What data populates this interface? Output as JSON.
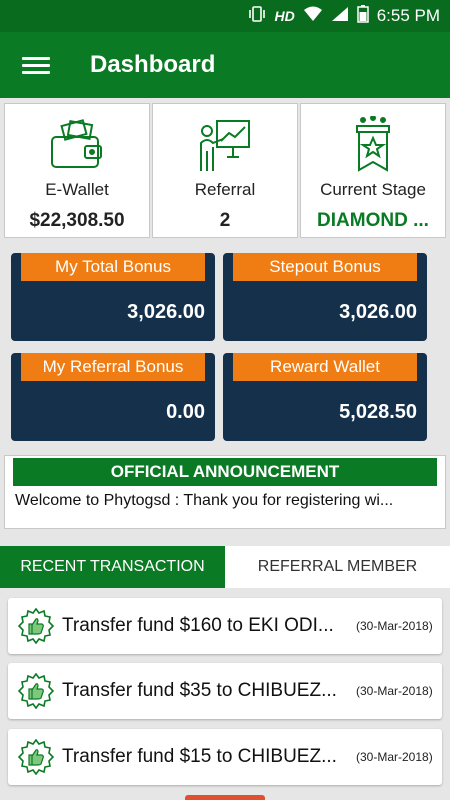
{
  "status": {
    "network": "HD",
    "time": "6:55 PM"
  },
  "header": {
    "title": "Dashboard"
  },
  "summary_cards": [
    {
      "label": "E-Wallet",
      "value": "$22,308.50",
      "icon": "wallet-icon"
    },
    {
      "label": "Referral",
      "value": "2",
      "icon": "presentation-icon"
    },
    {
      "label": "Current Stage",
      "value": "DIAMOND ...",
      "icon": "ribbon-star-icon"
    }
  ],
  "bonuses": [
    {
      "label": "My Total Bonus",
      "amount": "3,026.00"
    },
    {
      "label": "Stepout Bonus",
      "amount": "3,026.00"
    },
    {
      "label": "My Referral Bonus",
      "amount": "0.00"
    },
    {
      "label": "Reward Wallet",
      "amount": "5,028.50"
    }
  ],
  "announcement": {
    "title": "OFFICIAL ANNOUNCEMENT",
    "message": "Welcome to Phytogsd :   Thank you for registering wi..."
  },
  "tabs": [
    {
      "label": "RECENT TRANSACTION",
      "active": true
    },
    {
      "label": "REFERRAL MEMBER",
      "active": false
    }
  ],
  "transactions": [
    {
      "text": "Transfer fund $160 to EKI ODI...",
      "date": "(30-Mar-2018)"
    },
    {
      "text": "Transfer fund $35 to CHIBUEZ...",
      "date": "(30-Mar-2018)"
    },
    {
      "text": "Transfer fund $15 to CHIBUEZ...",
      "date": "(30-Mar-2018)"
    }
  ],
  "colors": {
    "primary": "#0b7a24",
    "accent": "#ef7d14",
    "navy": "#15304a"
  }
}
